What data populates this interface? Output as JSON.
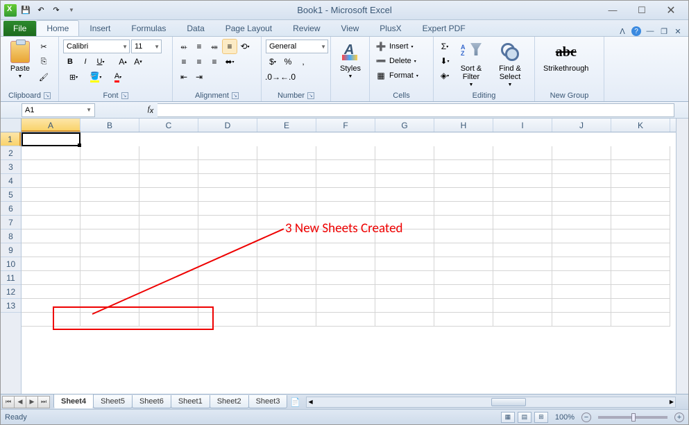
{
  "title": "Book1 - Microsoft Excel",
  "qat": {
    "save": "💾",
    "undo": "↶",
    "redo": "↷"
  },
  "tabs": {
    "file": "File",
    "items": [
      "Home",
      "Insert",
      "Formulas",
      "Data",
      "Page Layout",
      "Review",
      "View",
      "PlusX",
      "Expert PDF"
    ],
    "active": 0
  },
  "ribbon": {
    "clipboard": {
      "label": "Clipboard",
      "paste": "Paste"
    },
    "font": {
      "label": "Font",
      "name": "Calibri",
      "size": "11"
    },
    "alignment": {
      "label": "Alignment"
    },
    "number": {
      "label": "Number",
      "format": "General"
    },
    "styles": {
      "label": "Styles",
      "btn": "Styles"
    },
    "cells": {
      "label": "Cells",
      "insert": "Insert",
      "delete": "Delete",
      "format": "Format"
    },
    "editing": {
      "label": "Editing",
      "sort": "Sort & Filter",
      "find": "Find & Select"
    },
    "newgroup": {
      "label": "New Group",
      "strike": "Strikethrough"
    }
  },
  "namebox": "A1",
  "columns": [
    "A",
    "B",
    "C",
    "D",
    "E",
    "F",
    "G",
    "H",
    "I",
    "J",
    "K"
  ],
  "rows": [
    "1",
    "2",
    "3",
    "4",
    "5",
    "6",
    "7",
    "8",
    "9",
    "10",
    "11",
    "12",
    "13"
  ],
  "sheets": [
    "Sheet4",
    "Sheet5",
    "Sheet6",
    "Sheet1",
    "Sheet2",
    "Sheet3"
  ],
  "active_sheet": 0,
  "status": {
    "ready": "Ready",
    "zoom": "100%"
  },
  "annotation": {
    "text": "3 New Sheets Created"
  }
}
